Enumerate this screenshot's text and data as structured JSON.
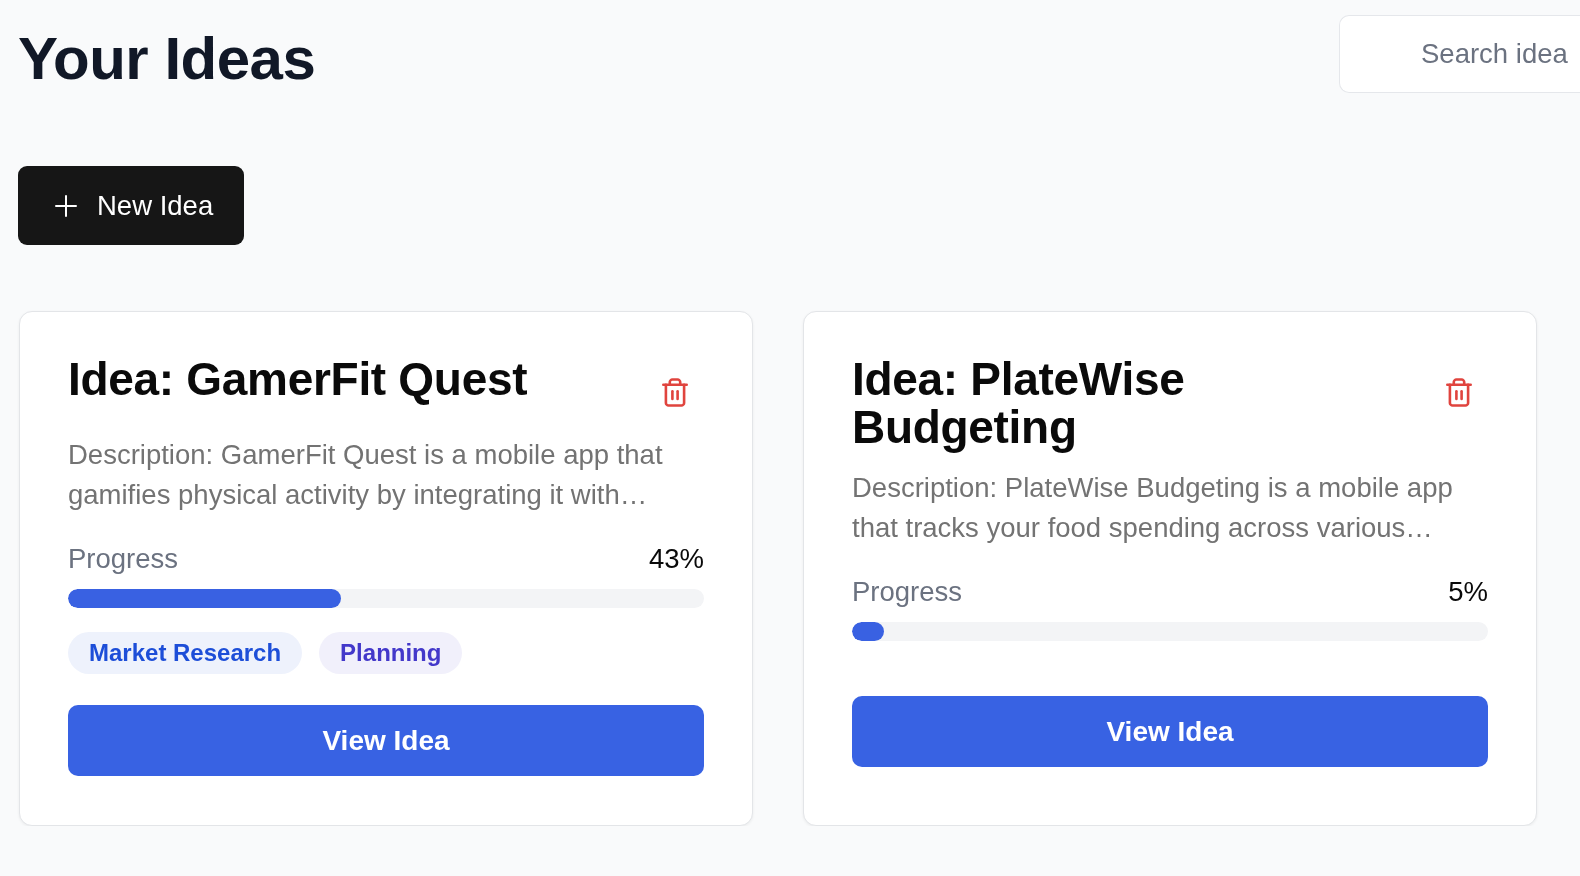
{
  "page": {
    "title": "Your Ideas"
  },
  "search": {
    "placeholder": "Search idea"
  },
  "new_button": {
    "label": "New Idea"
  },
  "ideas": [
    {
      "title": "Idea: GamerFit Quest",
      "description": "Description: GamerFit Quest is a mobile app that gamifies physical activity by integrating it with…",
      "progress_label": "Progress",
      "progress_text": "43%",
      "level": 0.43,
      "tags": [
        {
          "label": "Market Research",
          "color": "#1d4ed8"
        },
        {
          "label": "Planning",
          "color": "#4338ca"
        }
      ],
      "action": "View Idea"
    },
    {
      "title": "Idea: PlateWise Budgeting",
      "description": "Description: PlateWise Budgeting is a mobile app that tracks your food spending across various…",
      "progress_label": "Progress",
      "progress_text": "5%",
      "level": 0.05,
      "action": "View Idea"
    }
  ]
}
